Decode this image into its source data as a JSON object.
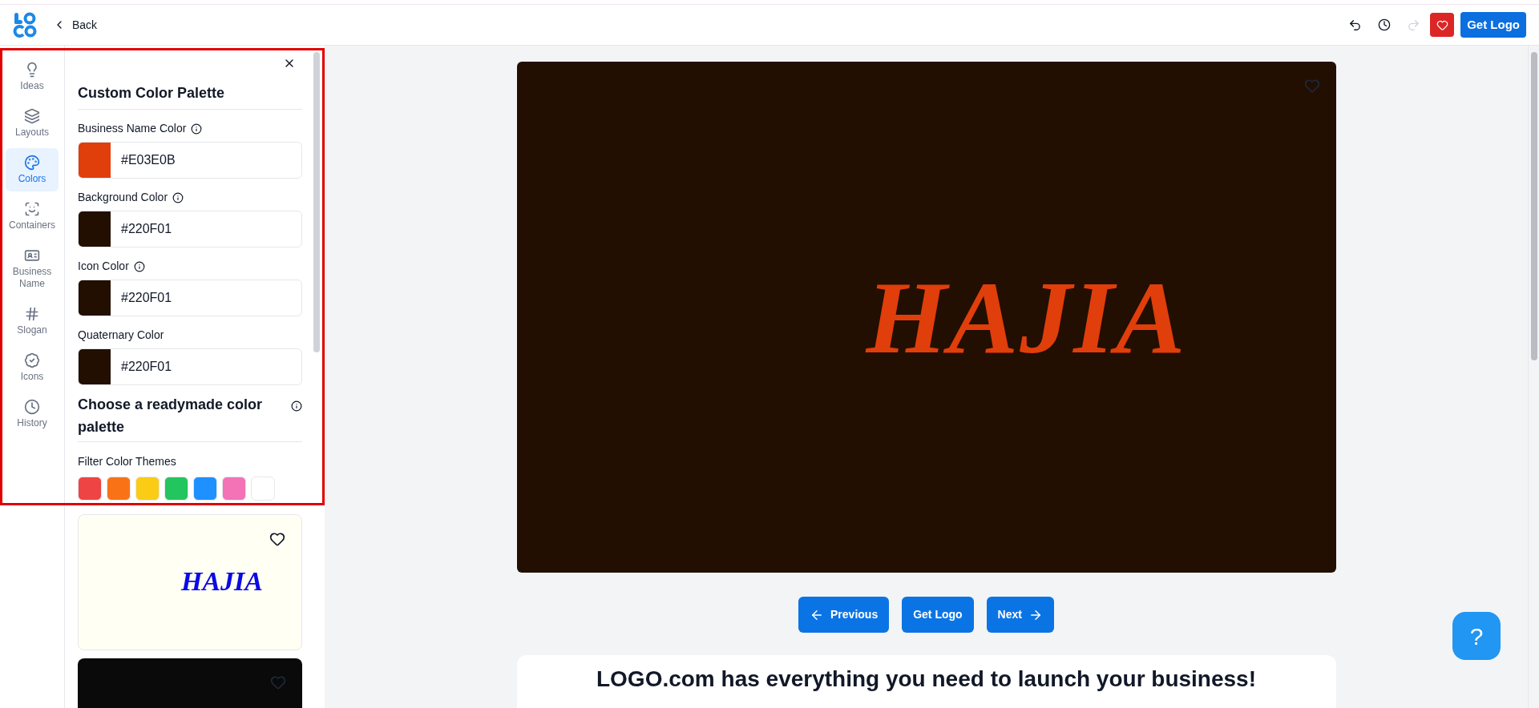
{
  "topbar": {
    "back_label": "Back",
    "redo_disabled": true,
    "get_logo": "Get Logo"
  },
  "sidebar": {
    "items": [
      {
        "kind": "bulb",
        "label": "Ideas",
        "selected": false
      },
      {
        "kind": "layers",
        "label": "Layouts",
        "selected": false
      },
      {
        "kind": "palette",
        "label": "Colors",
        "selected": true
      },
      {
        "kind": "frame",
        "label": "Containers",
        "selected": false
      },
      {
        "kind": "card",
        "label": "Business Name",
        "selected": false
      },
      {
        "kind": "hash",
        "label": "Slogan",
        "selected": false
      },
      {
        "kind": "badge",
        "label": "Icons",
        "selected": false
      },
      {
        "kind": "clock",
        "label": "History",
        "selected": false
      }
    ]
  },
  "panel": {
    "title": "Custom Color Palette",
    "color_fields": [
      {
        "label": "Business Name Color",
        "info": true,
        "color": "#e03e0b",
        "value": "#E03E0B"
      },
      {
        "label": "Background Color",
        "info": true,
        "color": "#220f01",
        "value": "#220F01"
      },
      {
        "label": "Icon Color",
        "info": true,
        "color": "#220f01",
        "value": "#220F01"
      },
      {
        "label": "Quaternary Color",
        "info": false,
        "color": "#220f01",
        "value": "#220F01"
      }
    ],
    "readymade_title": "Choose a readymade color palette",
    "filter_label": "Filter Color Themes",
    "filter_swatches": [
      {
        "color": "#ef4444"
      },
      {
        "color": "#f97316"
      },
      {
        "color": "#facc15"
      },
      {
        "color": "#22c55e"
      },
      {
        "color": "#1e90ff"
      },
      {
        "color": "#f472b6"
      },
      {
        "color": "#ffffff"
      }
    ],
    "thumbnails": [
      {
        "kind": "light",
        "text": "HAJIA"
      },
      {
        "kind": "dark"
      }
    ]
  },
  "preview": {
    "text": "HAJIA"
  },
  "nav_buttons": [
    {
      "kind": "previous",
      "label": "Previous"
    },
    {
      "kind": "plain",
      "label": "Get Logo"
    },
    {
      "kind": "next",
      "label": "Next"
    }
  ],
  "promo": {
    "heading": "LOGO.com has everything you need to launch your business!"
  },
  "help": {
    "label": "?"
  }
}
